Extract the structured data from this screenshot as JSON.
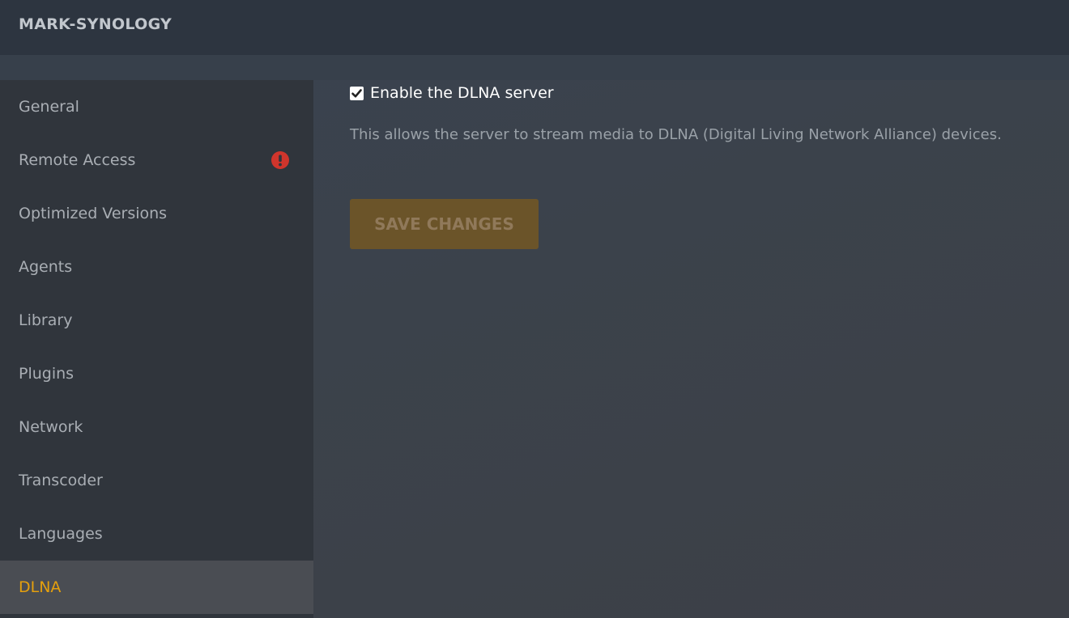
{
  "header": {
    "server_name": "MARK-SYNOLOGY"
  },
  "sidebar": {
    "items": [
      {
        "label": "General"
      },
      {
        "label": "Remote Access",
        "badge_icon": "exclamation-alert-icon",
        "badge_color": "#d0352c"
      },
      {
        "label": "Optimized Versions"
      },
      {
        "label": "Agents"
      },
      {
        "label": "Library"
      },
      {
        "label": "Plugins"
      },
      {
        "label": "Network"
      },
      {
        "label": "Transcoder"
      },
      {
        "label": "Languages"
      },
      {
        "label": "DLNA",
        "active": true
      }
    ],
    "active_color": "#e5a00d"
  },
  "dlna": {
    "enable_checked": true,
    "enable_label": "Enable the DLNA server",
    "description": "This allows the server to stream media to DLNA (Digital Living Network Alliance) devices.",
    "save_label": "SAVE CHANGES",
    "save_disabled": true
  }
}
